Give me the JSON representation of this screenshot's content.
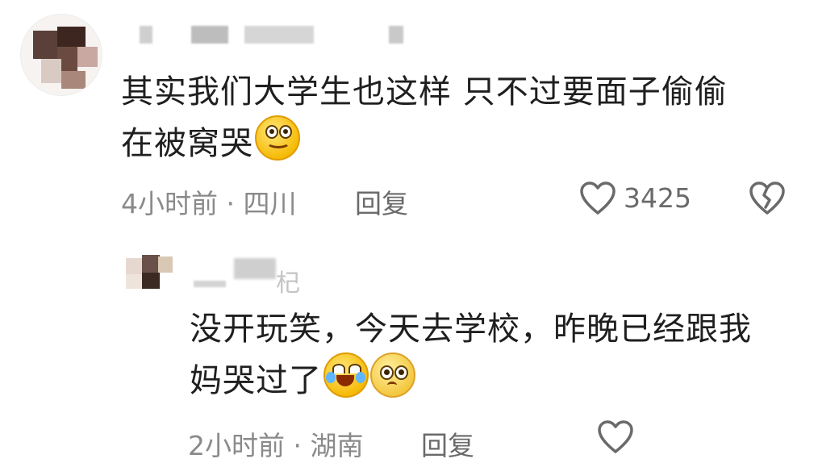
{
  "comment": {
    "text_line1": "其实我们大学生也这样 只不过要面子偷偷",
    "text_line2": "在被窝哭",
    "time_location": "4小时前 · 四川",
    "reply_label": "回复",
    "like_count": "3425"
  },
  "reply": {
    "username_partial": "杞",
    "text_line1": "没开玩笑，今天去学校，昨晚已经跟我",
    "text_line2": "妈哭过了",
    "time_location": "2小时前 · 湖南",
    "reply_label": "回复"
  },
  "colors": {
    "text": "#1f1f1f",
    "meta": "#8a8a8a",
    "icon": "#6a6a6a"
  }
}
